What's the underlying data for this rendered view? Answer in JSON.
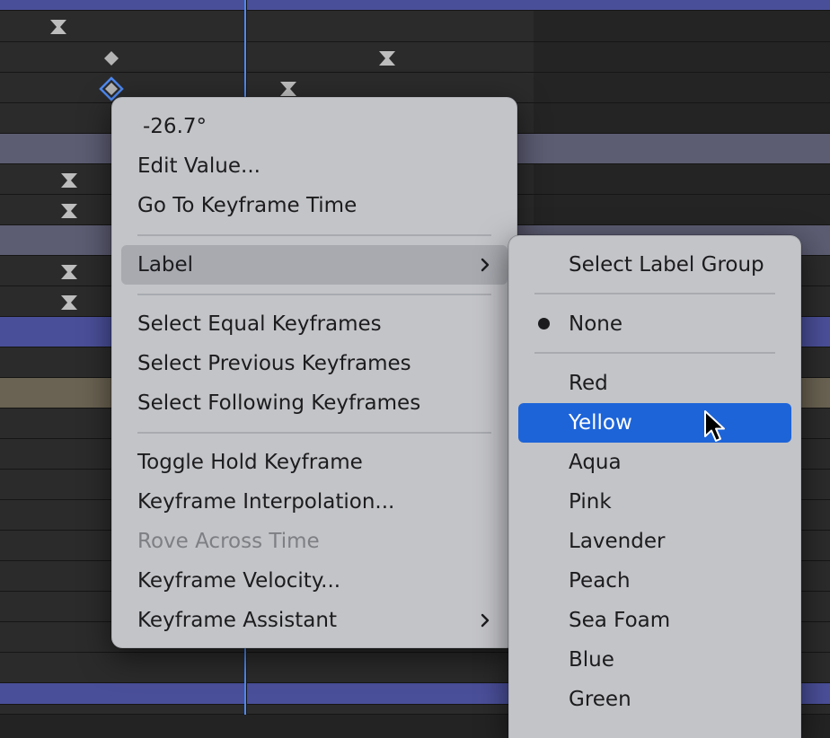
{
  "context_menu": {
    "value_item": "-26.7°",
    "edit_value": "Edit Value...",
    "go_to_keyframe_time": "Go To Keyframe Time",
    "label": "Label",
    "select_equal_keyframes": "Select Equal Keyframes",
    "select_previous_keyframes": "Select Previous Keyframes",
    "select_following_keyframes": "Select Following Keyframes",
    "toggle_hold_keyframe": "Toggle Hold Keyframe",
    "keyframe_interpolation": "Keyframe Interpolation...",
    "rove_across_time": "Rove Across Time",
    "keyframe_velocity": "Keyframe Velocity...",
    "keyframe_assistant": "Keyframe Assistant"
  },
  "label_submenu": {
    "select_label_group": "Select Label Group",
    "none": "None",
    "colors": [
      "Red",
      "Yellow",
      "Aqua",
      "Pink",
      "Lavender",
      "Peach",
      "Sea Foam",
      "Blue",
      "Green"
    ],
    "selected": "Yellow",
    "checked": "None"
  },
  "theme": {
    "menu_bg": "#c3c4c8",
    "selection": "#1d64d8",
    "playhead": "#4d88f0",
    "timeline_bg": "#2b2b2b"
  },
  "icons": {
    "submenu_arrow": "chevron-right-icon",
    "keyframe_hold": "hourglass-keyframe-icon",
    "keyframe_linear": "diamond-keyframe-icon",
    "cursor": "mouse-pointer-icon"
  }
}
